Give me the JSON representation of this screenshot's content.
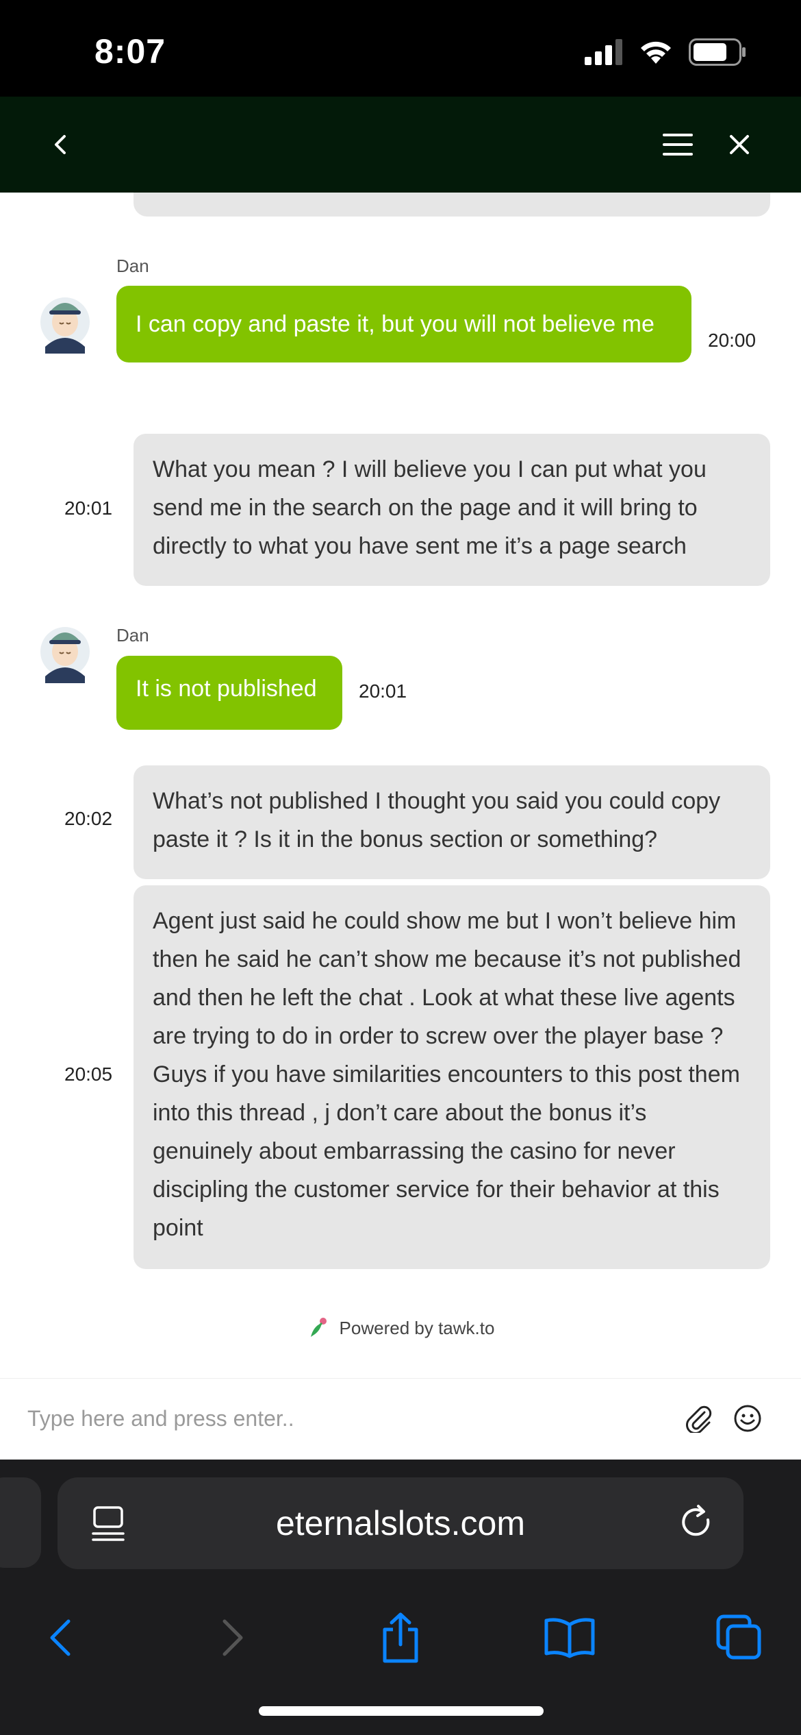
{
  "status_bar": {
    "time": "8:07"
  },
  "header": {
    "back_icon": "chevron-left-icon",
    "menu_icon": "hamburger-icon",
    "close_icon": "close-icon"
  },
  "messages": [
    {
      "type": "agent",
      "name": "Dan",
      "text": "I can copy and paste it, but you will not believe me",
      "time": "20:00"
    },
    {
      "type": "visitor",
      "text": "What you mean ? I will believe you I can put what you send me in the search on the page and it will bring to directly to what you have sent me it’s a page search",
      "time": "20:01"
    },
    {
      "type": "agent",
      "name": "Dan",
      "text": "It is not published",
      "time": "20:01"
    },
    {
      "type": "visitor",
      "text": "What’s not published I thought you said you could copy paste it ? Is it in the bonus section or something?",
      "time": "20:02"
    },
    {
      "type": "visitor",
      "text": "Agent just said he could show me but I won’t believe him then he said he can’t show me because it’s not published and then he left the chat . Look at what these live agents are trying to do in order to screw over the player base ? Guys if you have similarities encounters to this post them into this thread , j don’t care about the bonus it’s genuinely about embarrassing the casino for never discipling the customer service for their behavior at this point",
      "time": "20:05"
    }
  ],
  "footer": {
    "powered_by": "Powered by tawk.to"
  },
  "composer": {
    "placeholder": "Type here and press enter.."
  },
  "browser": {
    "url": "eternalslots.com"
  },
  "colors": {
    "agent_bubble": "#82c300",
    "visitor_bubble": "#e6e6e6",
    "header_bg": "#031a09",
    "ios_blue": "#0a84ff"
  }
}
